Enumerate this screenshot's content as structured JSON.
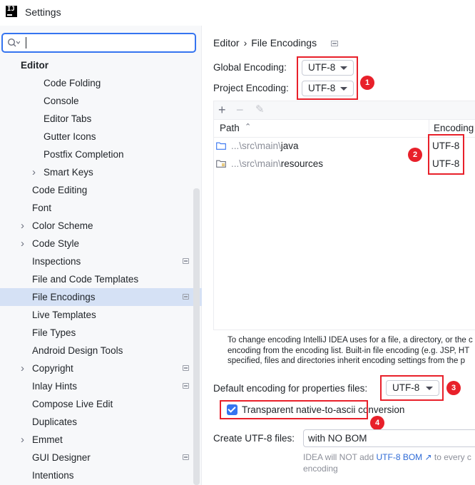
{
  "window": {
    "title": "Settings"
  },
  "search": {
    "value": "",
    "placeholder": ""
  },
  "sidebar": {
    "items": [
      {
        "label": "Editor",
        "level": 0
      },
      {
        "label": "Code Folding",
        "level": 2
      },
      {
        "label": "Console",
        "level": 2
      },
      {
        "label": "Editor Tabs",
        "level": 2
      },
      {
        "label": "Gutter Icons",
        "level": 2
      },
      {
        "label": "Postfix Completion",
        "level": 2
      },
      {
        "label": "Smart Keys",
        "level": 2,
        "expandable": true
      },
      {
        "label": "Code Editing",
        "level": 1
      },
      {
        "label": "Font",
        "level": 1
      },
      {
        "label": "Color Scheme",
        "level": 1,
        "expandable": true
      },
      {
        "label": "Code Style",
        "level": 1,
        "expandable": true
      },
      {
        "label": "Inspections",
        "level": 1,
        "project": true
      },
      {
        "label": "File and Code Templates",
        "level": 1
      },
      {
        "label": "File Encodings",
        "level": 1,
        "project": true,
        "selected": true
      },
      {
        "label": "Live Templates",
        "level": 1
      },
      {
        "label": "File Types",
        "level": 1
      },
      {
        "label": "Android Design Tools",
        "level": 1
      },
      {
        "label": "Copyright",
        "level": 1,
        "expandable": true,
        "project": true
      },
      {
        "label": "Inlay Hints",
        "level": 1,
        "project": true
      },
      {
        "label": "Compose Live Edit",
        "level": 1
      },
      {
        "label": "Duplicates",
        "level": 1
      },
      {
        "label": "Emmet",
        "level": 1,
        "expandable": true
      },
      {
        "label": "GUI Designer",
        "level": 1,
        "project": true
      },
      {
        "label": "Intentions",
        "level": 1
      }
    ]
  },
  "breadcrumb": {
    "parent": "Editor",
    "separator": "›",
    "current": "File Encodings"
  },
  "encodings": {
    "global_label": "Global Encoding:",
    "global_value": "UTF-8",
    "project_label": "Project Encoding:",
    "project_value": "UTF-8"
  },
  "table": {
    "toolbar": {
      "add": "+",
      "remove": "−",
      "edit": "✎"
    },
    "columns": {
      "path": "Path",
      "encoding": "Encoding"
    },
    "rows": [
      {
        "path_prefix": "...\\src\\main\\",
        "path_name": "java",
        "encoding": "UTF-8"
      },
      {
        "path_prefix": "...\\src\\main\\",
        "path_name": "resources",
        "encoding": "UTF-8"
      }
    ]
  },
  "help": {
    "line1": "To change encoding IntelliJ IDEA uses for a file, a directory, or the c",
    "line2": "encoding from the encoding list. Built-in file encoding (e.g. JSP, HT",
    "line3": "specified, files and directories inherit encoding settings from the p"
  },
  "properties": {
    "label": "Default encoding for properties files:",
    "value": "UTF-8",
    "checkbox_label": "Transparent native-to-ascii conversion",
    "checked": true
  },
  "bom": {
    "label": "Create UTF-8 files:",
    "value": "with NO BOM",
    "note_pre": "IDEA will NOT add",
    "note_link": "UTF-8 BOM ↗",
    "note_post": "to every c",
    "note_line2": "encoding"
  },
  "annotations": {
    "b1": "1",
    "b2": "2",
    "b3": "3",
    "b4": "4"
  },
  "colors": {
    "accent": "#3574f0",
    "selection": "#d5e1f5",
    "annotation": "#e8202a"
  }
}
